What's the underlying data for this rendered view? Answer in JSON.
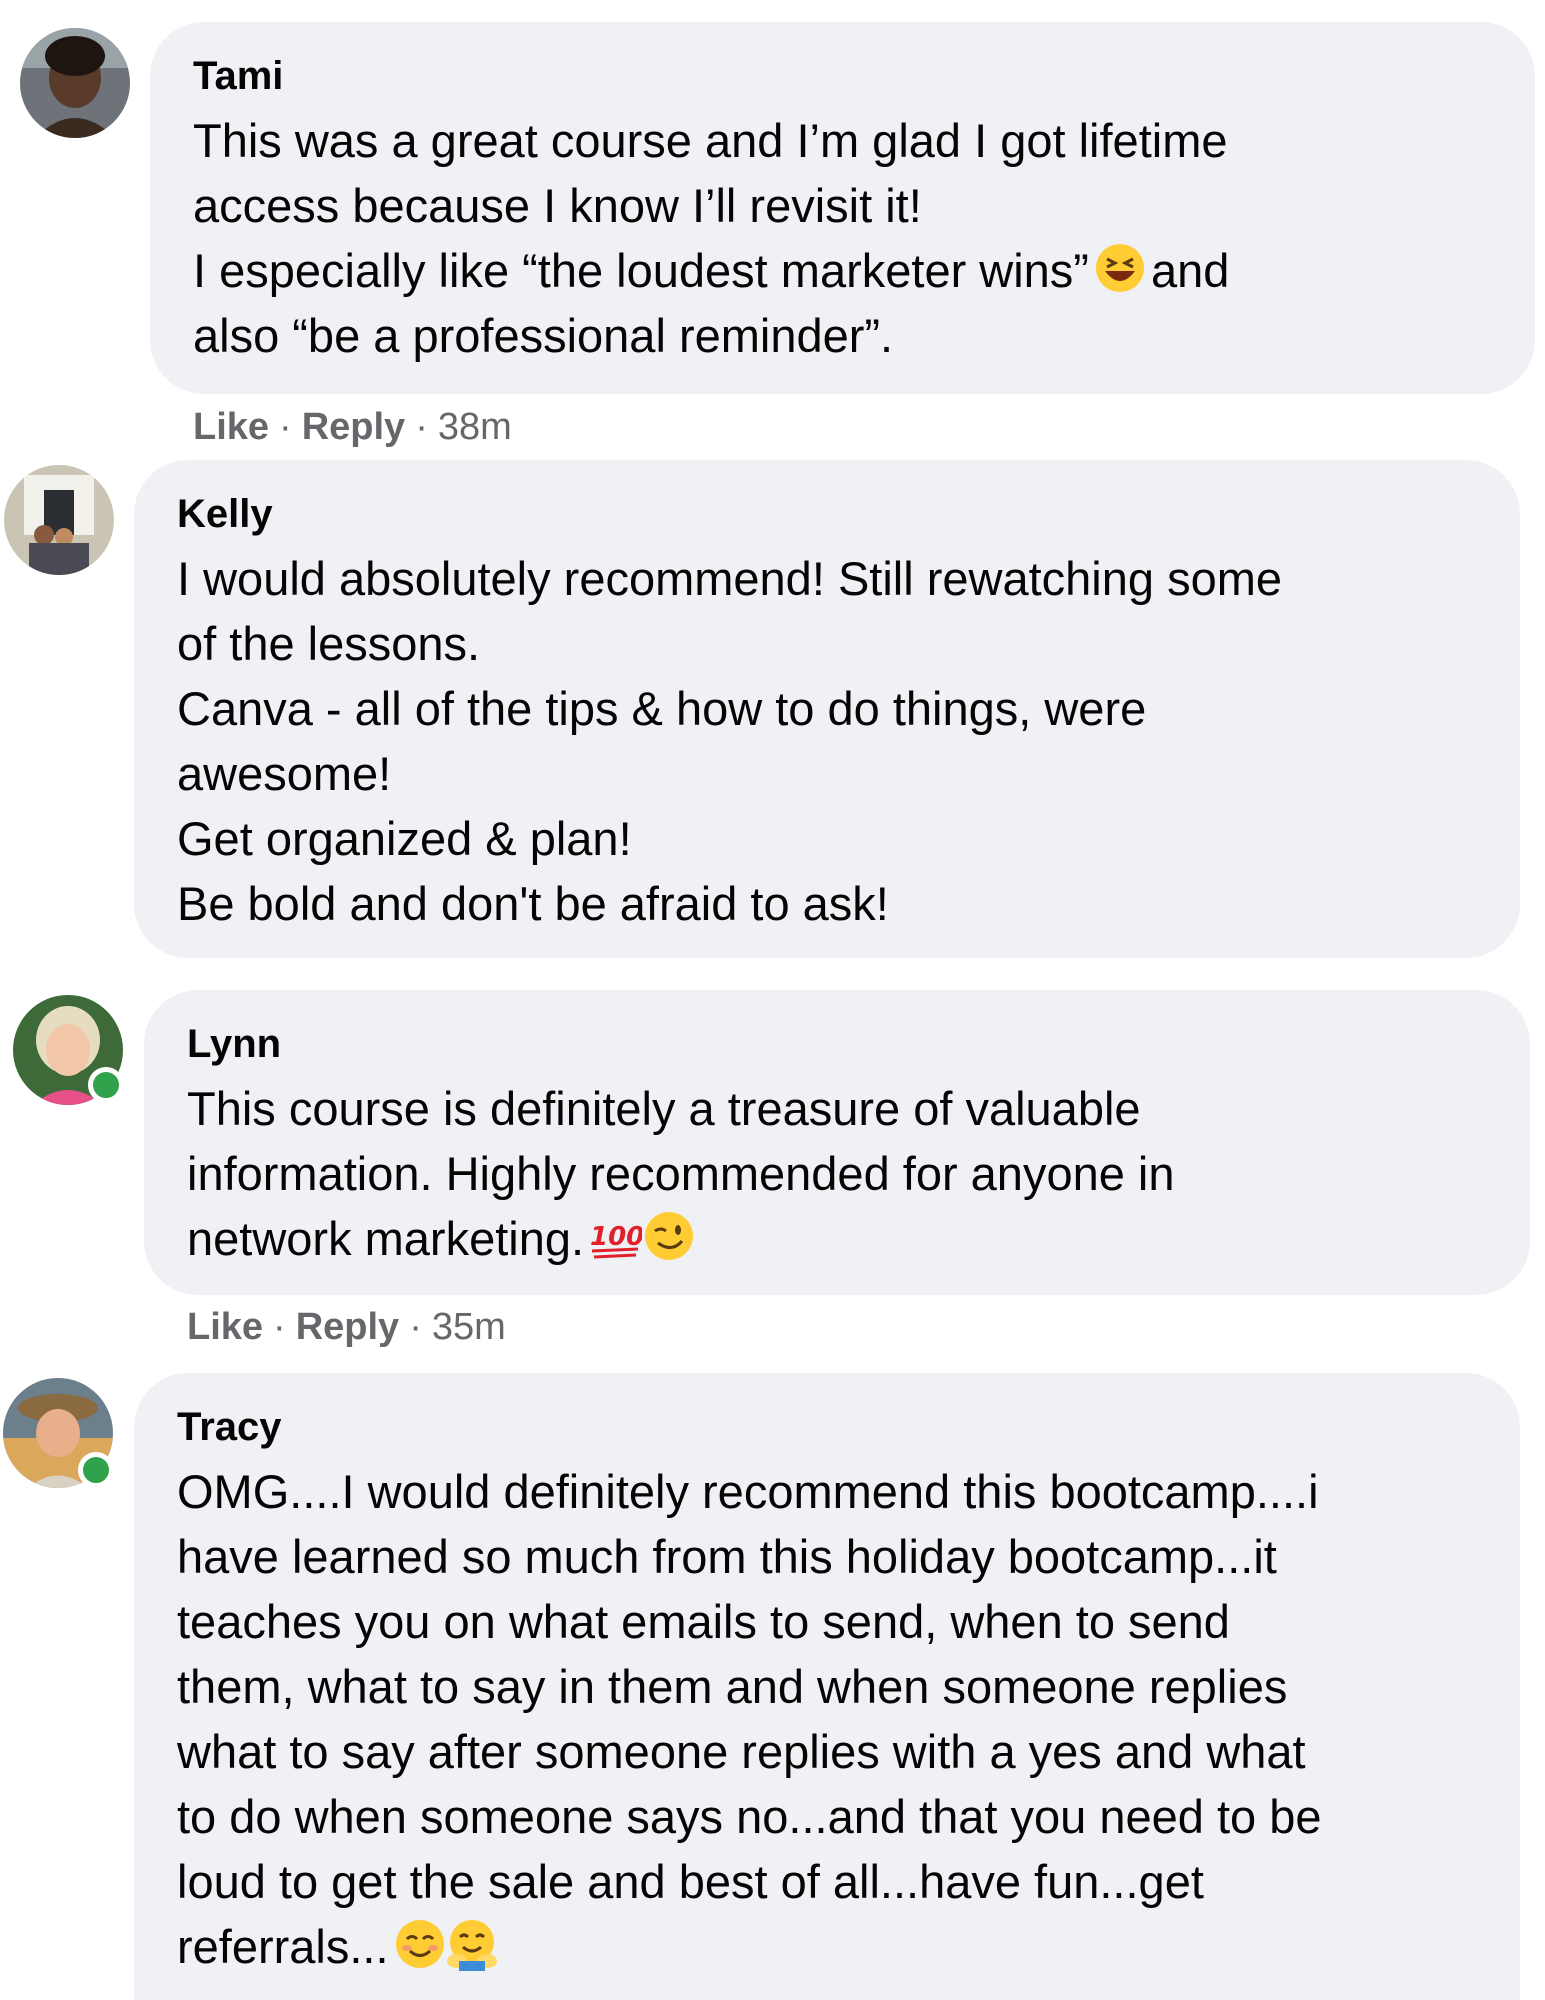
{
  "comments": [
    {
      "author": "Tami",
      "lines": [
        "This was a great course and I’m glad I got lifetime",
        "access because I know I’ll revisit it!",
        "I especially like “the loudest marketer wins”",
        "also “be a professional reminder”."
      ],
      "line3_after_emoji": "and",
      "emoji": [
        "laughing-emoji"
      ],
      "like_label": "Like",
      "reply_label": "Reply",
      "time": "38m",
      "online": false
    },
    {
      "author": "Kelly",
      "lines": [
        "I would absolutely recommend! Still rewatching some",
        "of the lessons.",
        "Canva - all of the tips & how to do things, were",
        "awesome!",
        "Get organized & plan!",
        "Be bold and don't be afraid to ask!"
      ],
      "online": false
    },
    {
      "author": "Lynn",
      "lines": [
        "This course is definitely a treasure of valuable",
        "information. Highly recommended for anyone in",
        "network marketing."
      ],
      "emoji": [
        "hundred-points-emoji",
        "winking-emoji"
      ],
      "like_label": "Like",
      "reply_label": "Reply",
      "time": "35m",
      "online": true
    },
    {
      "author": "Tracy",
      "lines": [
        "OMG....I would definitely recommend this bootcamp....i",
        "have learned so much from this holiday bootcamp...it",
        "teaches you on what emails to send, when to send",
        "them, what to say in them and when someone replies",
        "what to say after someone replies with a yes and what",
        "to do when someone says no...and that you need to be",
        "loud to get the sale and best of all...have fun...get",
        "referrals..."
      ],
      "emoji": [
        "smiling-emoji",
        "hugging-emoji"
      ],
      "online": true
    }
  ],
  "colors": {
    "bubble": "#eff1f5",
    "meta_text": "#65676b",
    "online_dot": "#31a24c"
  }
}
